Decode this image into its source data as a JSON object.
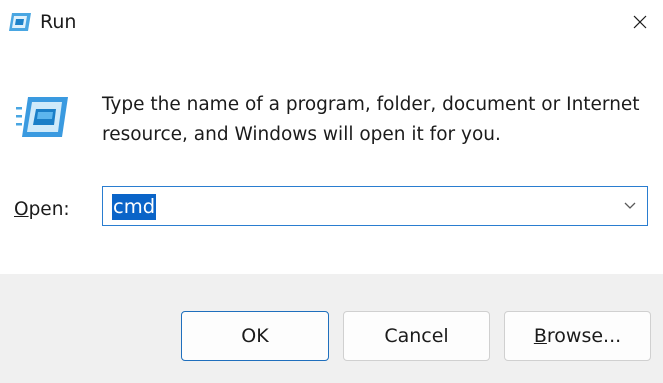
{
  "window": {
    "title": "Run",
    "close_icon": "close-icon",
    "app_icon": "run-icon"
  },
  "body": {
    "description": "Type the name of a program, folder, document or Internet resource, and Windows will open it for you.",
    "open_label_mnemonic": "O",
    "open_label_rest": "pen:",
    "open_value": "cmd"
  },
  "buttons": {
    "ok": "OK",
    "cancel": "Cancel",
    "browse_mnemonic": "B",
    "browse_rest": "rowse..."
  },
  "colors": {
    "accent": "#0a64c8",
    "focus_border": "#2a7dd0",
    "footer_bg": "#f0f0f0"
  }
}
